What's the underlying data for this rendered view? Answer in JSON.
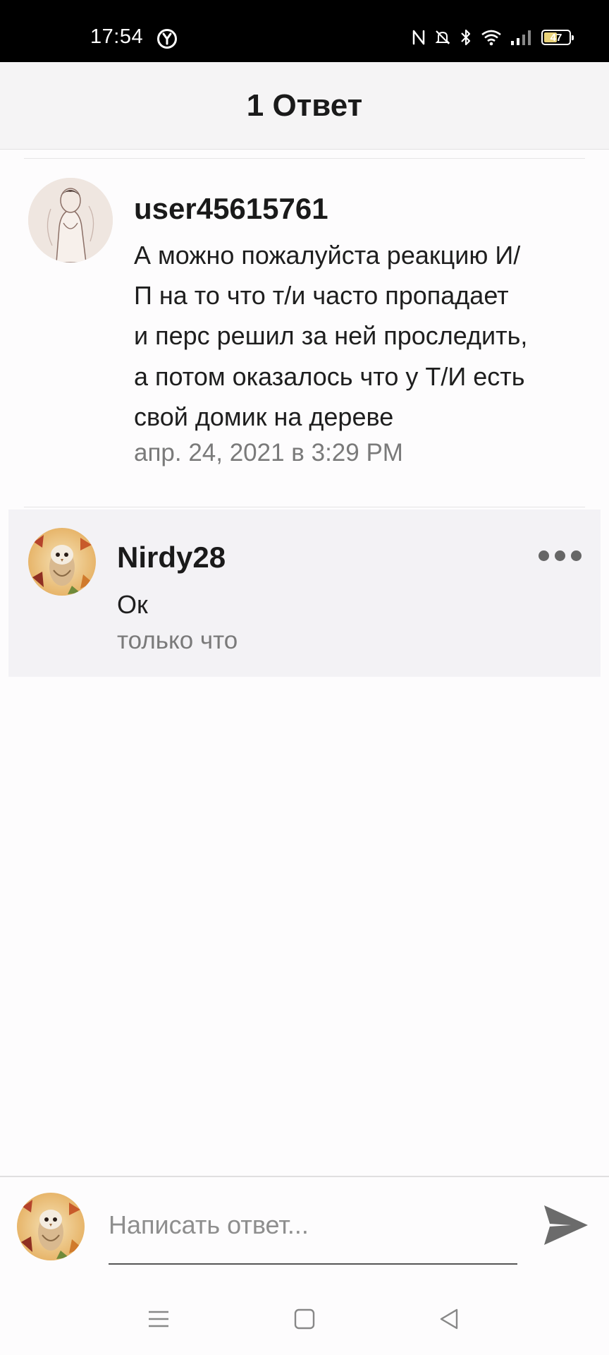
{
  "status_bar": {
    "time": "17:54",
    "battery": "47"
  },
  "header": {
    "title": "1 Ответ"
  },
  "comment": {
    "username": "user45615761",
    "lines": [
      "А можно пожалуйста реакцию И/",
      "П на то что т/и часто пропадает",
      "и перс решил за ней проследить,",
      "а потом оказалось что у Т/И есть",
      "свой домик на дереве"
    ],
    "timestamp": "апр. 24, 2021 в 3:29 PM"
  },
  "reply": {
    "username": "Nirdy28",
    "text": "Ок",
    "timestamp": "только что"
  },
  "composer": {
    "placeholder": "Написать ответ..."
  },
  "colors": {
    "header_bg": "#f5f4f5",
    "reply_bg": "#f3f2f5",
    "secondary_text": "#7a7a7a",
    "send_icon": "#6b6b6b"
  },
  "icons": {
    "status_left": "yandex-icon",
    "status_right": [
      "nfc-icon",
      "mute-icon",
      "bluetooth-icon",
      "wifi-icon",
      "signal-icon",
      "battery-icon"
    ],
    "more": "more-dots-icon",
    "send": "send-icon",
    "nav": [
      "menu-icon",
      "home-icon",
      "back-icon"
    ]
  }
}
